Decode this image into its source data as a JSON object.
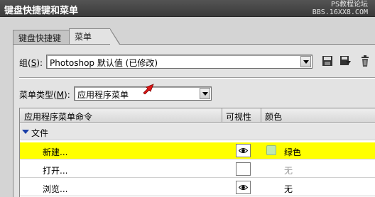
{
  "window": {
    "title": "键盘快捷键和菜单",
    "watermark_line1": "PS教程论坛",
    "watermark_line2": "BBS.16XX8.COM"
  },
  "tabs": [
    {
      "label": "键盘快捷键",
      "active": false
    },
    {
      "label": "菜单",
      "active": true
    }
  ],
  "set": {
    "label_prefix": "组(",
    "label_key": "S",
    "label_suffix": "):",
    "value": "Photoshop 默认值 (已修改)"
  },
  "menu_type": {
    "label_prefix": "菜单类型(",
    "label_key": "M",
    "label_suffix": "):",
    "value": "应用程序菜单"
  },
  "table": {
    "headers": {
      "command": "应用程序菜单命令",
      "visibility": "可视性",
      "color": "颜色"
    },
    "group": {
      "label": "文件"
    },
    "rows": [
      {
        "command": "新建...",
        "visible": true,
        "color": "绿色",
        "selected": true
      },
      {
        "command": "打开...",
        "visible": false,
        "color": "无",
        "selected": false
      },
      {
        "command": "浏览...",
        "visible": true,
        "color": "无",
        "selected": false
      }
    ]
  },
  "colors": {
    "selected_row": "#ffff00",
    "green_swatch": "#bfe8b0",
    "accent_arrow": "#e01818"
  }
}
